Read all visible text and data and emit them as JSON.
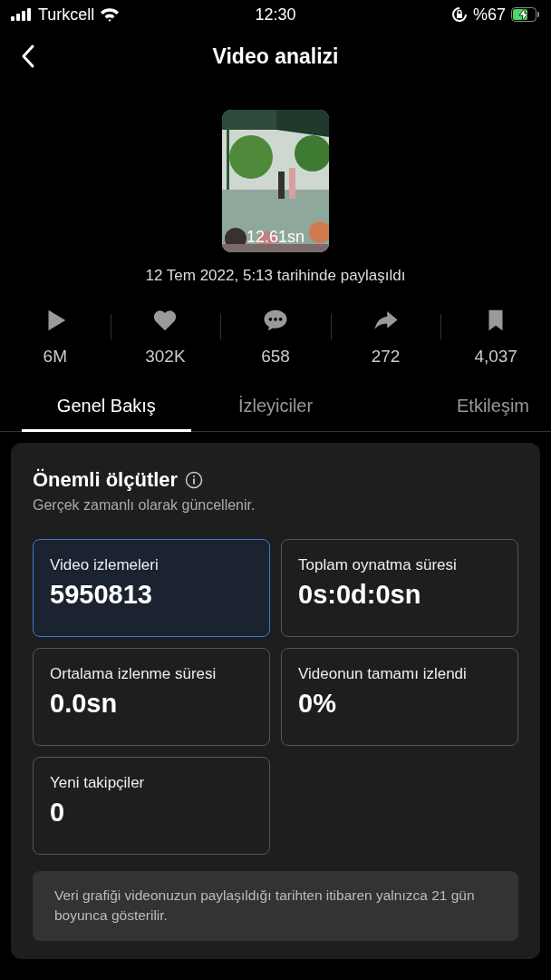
{
  "status_bar": {
    "carrier": "Turkcell",
    "time": "12:30",
    "battery": "%67",
    "charging": true
  },
  "header": {
    "title": "Video analizi"
  },
  "video": {
    "kind": "picture",
    "duration": "12.61sn",
    "posted": "12 Tem 2022, 5:13 tarihinde paylaşıldı"
  },
  "stats": [
    {
      "kind": "play",
      "value": "6M"
    },
    {
      "kind": "like",
      "value": "302K"
    },
    {
      "kind": "comment",
      "value": "658"
    },
    {
      "kind": "share",
      "value": "272"
    },
    {
      "kind": "save",
      "value": "4,037"
    }
  ],
  "tabs": [
    {
      "label": "Genel Bakış",
      "selected": true
    },
    {
      "label": "İzleyiciler",
      "selected": false
    },
    {
      "label": "Etkileşim",
      "selected": false
    }
  ],
  "metrics_panel": {
    "title": "Önemli ölçütler",
    "subtitle": "Gerçek zamanlı olarak güncellenir.",
    "metrics": [
      {
        "label": "Video izlemeleri",
        "value": "5950813",
        "selected": true
      },
      {
        "label": "Toplam oynatma süresi",
        "value": "0s:0d:0sn",
        "selected": false
      },
      {
        "label": "Ortalama izlenme süresi",
        "value": "0.0sn",
        "selected": false
      },
      {
        "label": "Videonun tamamı izlendi",
        "value": "0%",
        "selected": false
      },
      {
        "label": "Yeni takipçiler",
        "value": "0",
        "selected": false
      }
    ],
    "note": "Veri grafiği videonuzun paylaşıldığı tarihten itibaren yalnızca 21 gün boyunca gösterilir."
  }
}
